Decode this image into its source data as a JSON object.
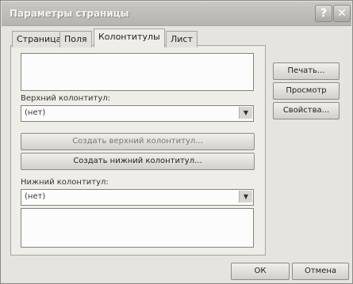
{
  "title": "Параметры страницы",
  "tabs": [
    "Страница",
    "Поля",
    "Колонтитулы",
    "Лист"
  ],
  "header": {
    "label": "Верхний колонтитул:",
    "value": "(нет)"
  },
  "footer": {
    "label": "Нижний колонтитул:",
    "value": "(нет)"
  },
  "buttons": {
    "print": "Печать...",
    "preview": "Просмотр",
    "properties": "Свойства...",
    "create_header": "Создать верхний колонтитул...",
    "create_footer": "Создать нижний колонтитул...",
    "ok": "ОК",
    "cancel": "Отмена"
  },
  "icons": {
    "help": "?",
    "close": "✕",
    "dropdown": "▼"
  }
}
